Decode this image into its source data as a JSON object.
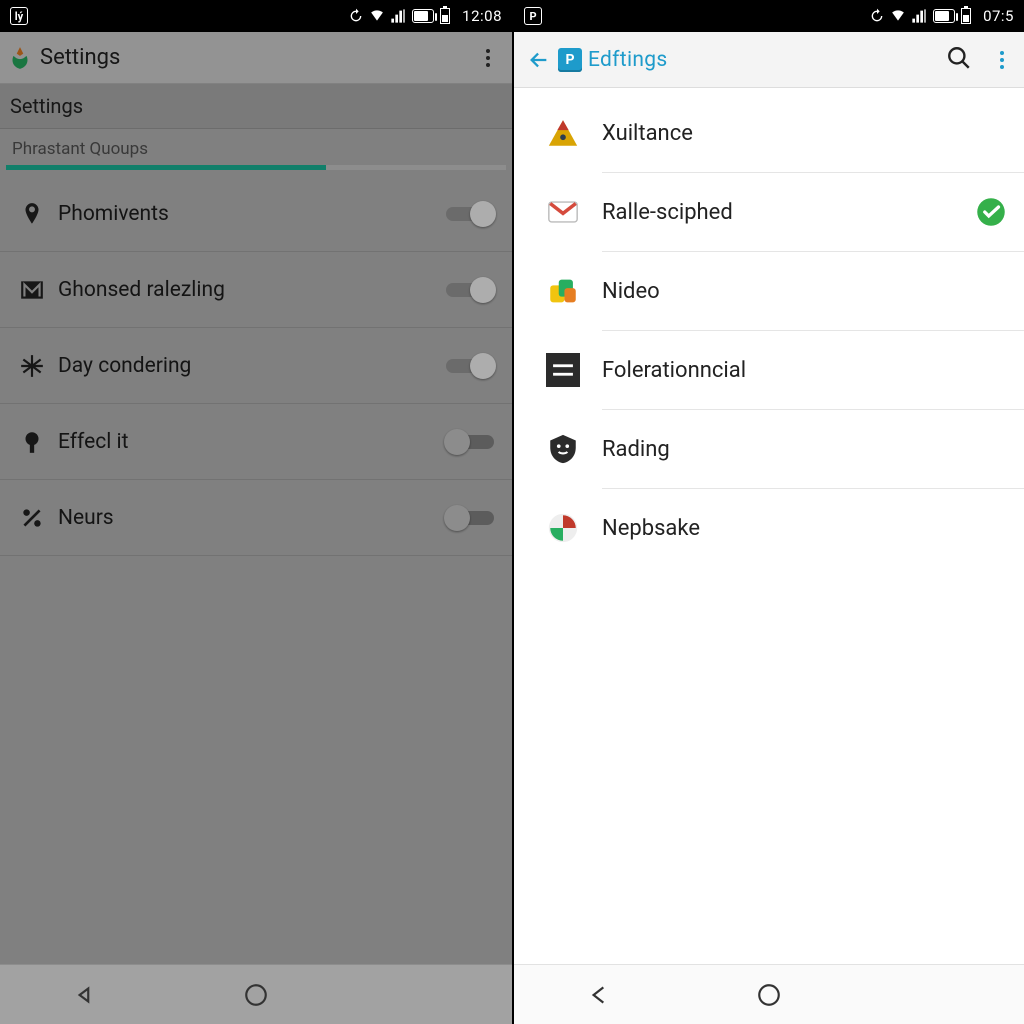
{
  "left": {
    "status": {
      "clock": "12:08"
    },
    "appbar": {
      "title": "Settings"
    },
    "section": "Settings",
    "subcategory": "Phrastant Quoups",
    "progress_pct": 64,
    "rows": [
      {
        "icon": "pin-icon",
        "label": "Phomivents",
        "toggle": "on"
      },
      {
        "icon": "letter-m-icon",
        "label": "Ghonsed ralezling",
        "toggle": "on"
      },
      {
        "icon": "snowflake-icon",
        "label": "Day condering",
        "toggle": "on"
      },
      {
        "icon": "tree-icon",
        "label": "Effecl it",
        "toggle": "off"
      },
      {
        "icon": "percent-icon",
        "label": "Neurs",
        "toggle": "off"
      }
    ]
  },
  "right": {
    "status": {
      "clock": "07:5"
    },
    "appbar": {
      "title": "Edftings",
      "brand_letter": "P"
    },
    "rows": [
      {
        "icon": "triangle-app-icon",
        "label": "Xuiltance",
        "checked": false
      },
      {
        "icon": "gmail-icon",
        "label": "Ralle-sciphed",
        "checked": true
      },
      {
        "icon": "files-app-icon",
        "label": "Nideo",
        "checked": false
      },
      {
        "icon": "lines-app-icon",
        "label": "Folerationncial",
        "checked": false
      },
      {
        "icon": "shield-app-icon",
        "label": "Rading",
        "checked": false
      },
      {
        "icon": "circle-app-icon",
        "label": "Nepbsake",
        "checked": false
      }
    ]
  },
  "colors": {
    "teal": "#1abc9c",
    "blue": "#1E9BCB",
    "green_check": "#35B04A"
  }
}
